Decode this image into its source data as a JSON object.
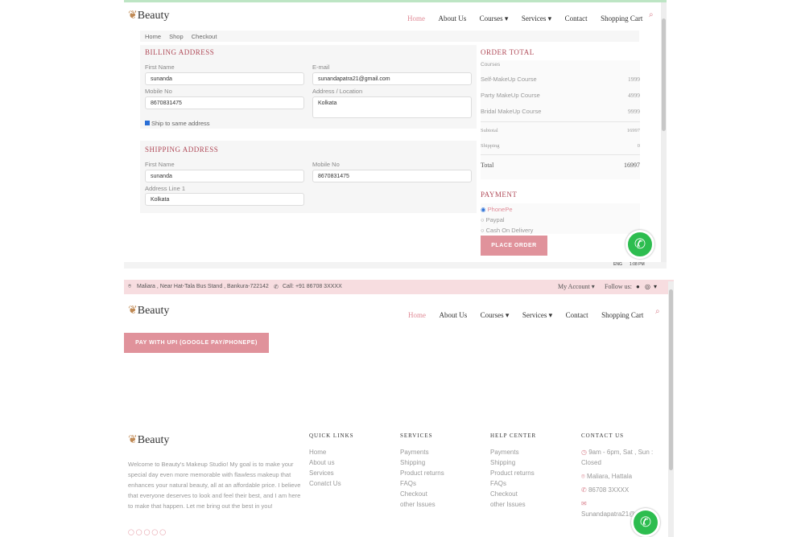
{
  "brand": {
    "name": "Beauty",
    "leaf_color": "#c08a55",
    "accent": "#e08a96"
  },
  "nav": {
    "items": [
      "Home",
      "About Us",
      "Courses",
      "Services",
      "Contact",
      "Shopping Cart"
    ],
    "active": "Home"
  },
  "breadcrumb": [
    "Home",
    "Shop",
    "Checkout"
  ],
  "billing": {
    "title": "BILLING ADDRESS",
    "first_name_label": "First Name",
    "first_name": "sunanda",
    "email_label": "E-mail",
    "email": "sunandapatra21@gmail.com",
    "mobile_label": "Mobile No",
    "mobile": "8670831475",
    "address_label": "Address / Location",
    "address": "Kolkata",
    "ship_same_label": "Ship to same address"
  },
  "shipping": {
    "title": "SHIPPING ADDRESS",
    "first_name_label": "First Name",
    "first_name": "sunanda",
    "mobile_label": "Mobile No",
    "mobile": "8670831475",
    "address1_label": "Address Line 1",
    "address1": "Kolkata"
  },
  "order_total": {
    "title": "ORDER TOTAL",
    "header": "Courses",
    "items": [
      {
        "name": "Self-MakeUp Course",
        "price": "1999"
      },
      {
        "name": "Party MakeUp Course",
        "price": "4999"
      },
      {
        "name": "Bridal MakeUp Course",
        "price": "9999"
      }
    ],
    "subtotal_label": "Subtotal",
    "subtotal": "16997",
    "shipping_label": "Shipping",
    "shipping": "0",
    "total_label": "Total",
    "total": "16997"
  },
  "payment": {
    "title": "PAYMENT",
    "options": [
      "PhonePe",
      "Paypal",
      "Cash On Delivery"
    ],
    "selected": "PhonePe",
    "place_order": "PLACE ORDER"
  },
  "topbar": {
    "address": "Maliara , Near Hat-Tala Bus Stand , Bankura-722142",
    "call": "Call: +91 86708 3XXXX",
    "account": "My Account",
    "follow": "Follow us:"
  },
  "upi_button": "PAY WITH UPI (GOOGLE PAY/PHONEPE)",
  "footer": {
    "about": "Welcome to Beauty's Makeup Studio! My goal is to make your special day even more memorable with flawless makeup that enhances your natural beauty, all at an affordable price. I believe that everyone deserves to look and feel their best, and I am here to make that happen. Let me bring out the best in you!",
    "quick_links": {
      "title": "QUICK LINKS",
      "items": [
        "Home",
        "About us",
        "Services",
        "Conatct Us"
      ]
    },
    "services": {
      "title": "SERVICES",
      "items": [
        "Payments",
        "Shipping",
        "Product returns",
        "FAQs",
        "Checkout",
        "other Issues"
      ]
    },
    "help": {
      "title": "HELP CENTER",
      "items": [
        "Payments",
        "Shipping",
        "Product returns",
        "FAQs",
        "Checkout",
        "other Issues"
      ]
    },
    "contact": {
      "title": "CONTACT US",
      "hours": "9am - 6pm, Sat , Sun : Closed",
      "location": "Maliara, Hattala",
      "phone": "86708 3XXXX",
      "email": "Sunandapatra21@G...m"
    }
  },
  "taskbar": {
    "lang": "ENG",
    "time": "1:08 PM"
  }
}
